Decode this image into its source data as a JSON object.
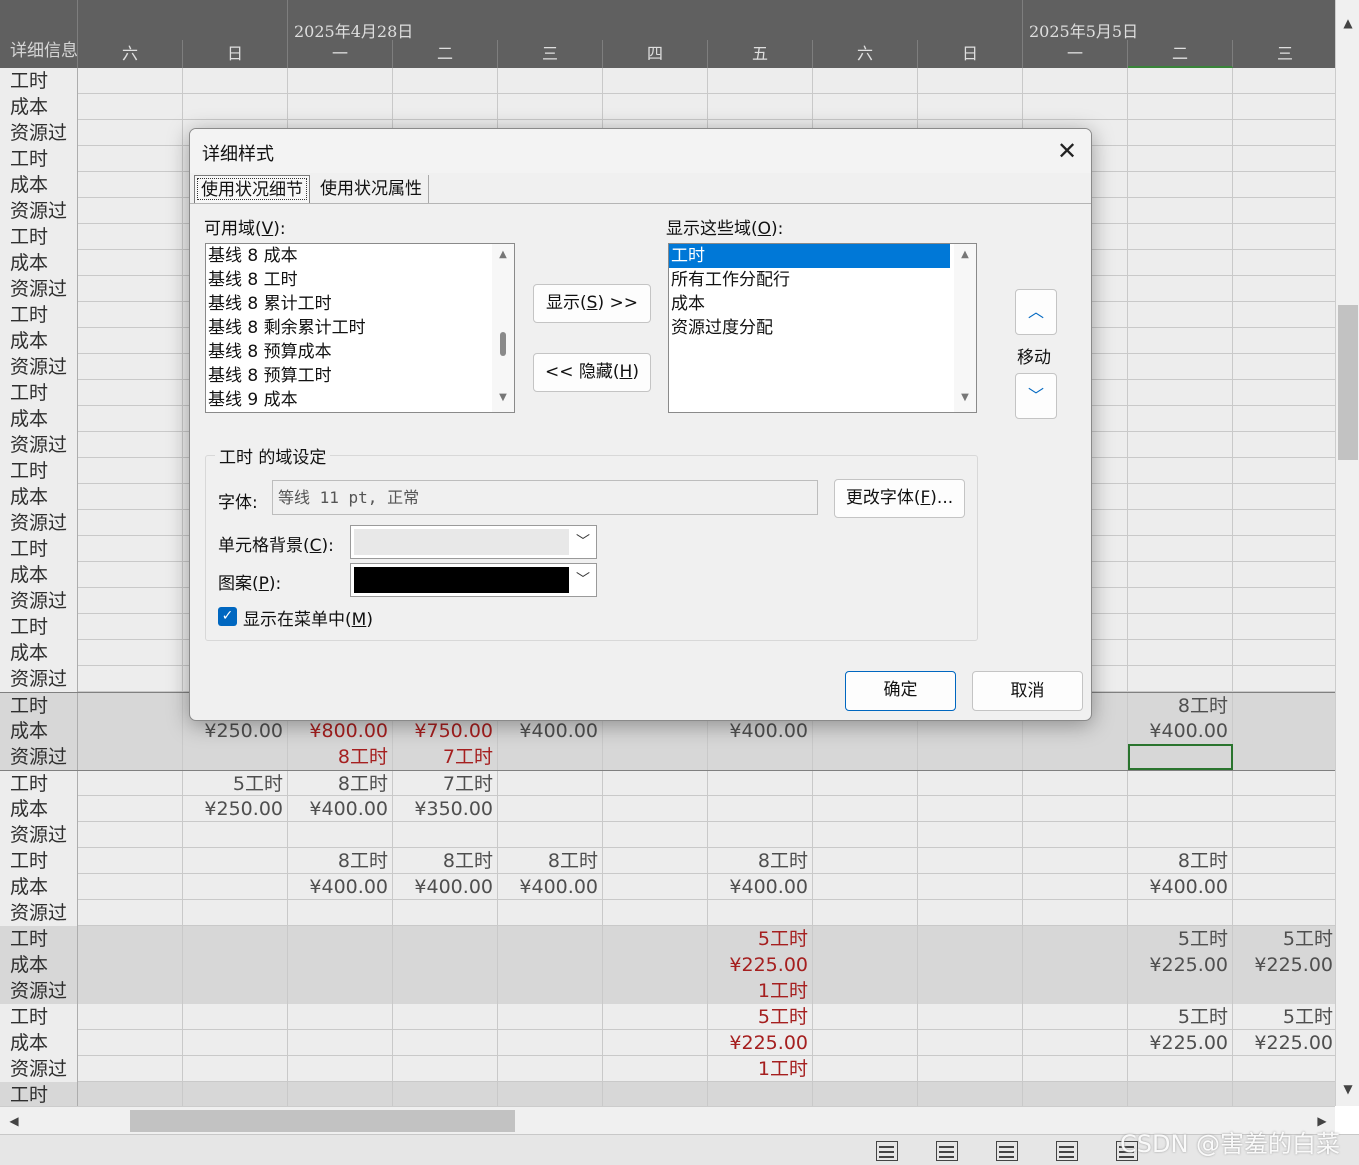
{
  "timescale": {
    "corner_label": "详细信息",
    "weeks": [
      "2025年4月28日",
      "2025年5月5日"
    ],
    "days": [
      "六",
      "日",
      "一",
      "二",
      "三",
      "四",
      "五",
      "六",
      "日",
      "一",
      "二",
      "三"
    ]
  },
  "grid": {
    "rows": [
      {
        "label": "工时",
        "cells": [
          "",
          "",
          "",
          "",
          "",
          "",
          "",
          "",
          "",
          "",
          "",
          ""
        ]
      },
      {
        "label": "成本",
        "cells": [
          "",
          "",
          "",
          "",
          "",
          "",
          "",
          "",
          "",
          "",
          "",
          ""
        ]
      },
      {
        "label": "资源过",
        "cells": [
          "",
          "",
          "",
          "",
          "",
          "",
          "",
          "",
          "",
          "",
          "",
          ""
        ]
      },
      {
        "label": "工时",
        "cells": [
          "",
          "",
          "",
          "",
          "",
          "",
          "",
          "",
          "",
          "",
          "",
          ""
        ]
      },
      {
        "label": "成本",
        "cells": [
          "",
          "",
          "",
          "",
          "",
          "",
          "",
          "",
          "",
          "",
          "",
          ""
        ]
      },
      {
        "label": "资源过",
        "cells": [
          "",
          "",
          "",
          "",
          "",
          "",
          "",
          "",
          "",
          "",
          "",
          ""
        ]
      },
      {
        "label": "工时",
        "cells": [
          "",
          "",
          "",
          "",
          "",
          "",
          "",
          "",
          "",
          "",
          "",
          ""
        ]
      },
      {
        "label": "成本",
        "cells": [
          "",
          "",
          "",
          "",
          "",
          "",
          "",
          "",
          "",
          "",
          "",
          ""
        ]
      },
      {
        "label": "资源过",
        "cells": [
          "",
          "",
          "",
          "",
          "",
          "",
          "",
          "",
          "",
          "",
          "",
          ""
        ]
      },
      {
        "label": "工时",
        "cells": [
          "",
          "",
          "",
          "",
          "",
          "",
          "",
          "",
          "",
          "",
          "",
          ""
        ]
      },
      {
        "label": "成本",
        "cells": [
          "",
          "",
          "",
          "",
          "",
          "",
          "",
          "",
          "",
          "",
          "",
          ""
        ]
      },
      {
        "label": "资源过",
        "cells": [
          "",
          "",
          "",
          "",
          "",
          "",
          "",
          "",
          "",
          "",
          "",
          ""
        ]
      },
      {
        "label": "工时",
        "cells": [
          "",
          "",
          "",
          "",
          "",
          "",
          "",
          "",
          "",
          "",
          "",
          ""
        ]
      },
      {
        "label": "成本",
        "cells": [
          "",
          "",
          "",
          "",
          "",
          "",
          "",
          "",
          "",
          "",
          "",
          ""
        ]
      },
      {
        "label": "资源过",
        "cells": [
          "",
          "",
          "",
          "",
          "",
          "",
          "",
          "",
          "",
          "",
          "",
          ""
        ]
      },
      {
        "label": "工时",
        "cells": [
          "",
          "",
          "",
          "",
          "",
          "",
          "",
          "",
          "",
          "",
          "",
          ""
        ]
      },
      {
        "label": "成本",
        "cells": [
          "",
          "",
          "",
          "",
          "",
          "",
          "",
          "",
          "",
          "",
          "",
          ""
        ]
      },
      {
        "label": "资源过",
        "cells": [
          "",
          "",
          "",
          "",
          "",
          "",
          "",
          "",
          "",
          "",
          "",
          ""
        ]
      },
      {
        "label": "工时",
        "cells": [
          "",
          "",
          "",
          "",
          "",
          "",
          "",
          "",
          "",
          "",
          "",
          ""
        ]
      },
      {
        "label": "成本",
        "cells": [
          "",
          "",
          "",
          "",
          "",
          "",
          "",
          "",
          "",
          "",
          "",
          ""
        ]
      },
      {
        "label": "资源过",
        "cells": [
          "",
          "",
          "",
          "",
          "",
          "",
          "",
          "",
          "",
          "",
          "",
          ""
        ]
      },
      {
        "label": "工时",
        "cells": [
          "",
          "",
          "",
          "",
          "",
          "",
          "",
          "",
          "",
          "",
          "",
          ""
        ]
      },
      {
        "label": "成本",
        "cells": [
          "",
          "",
          "",
          "",
          "",
          "",
          "",
          "",
          "",
          "",
          "",
          ""
        ]
      },
      {
        "label": "资源过",
        "cells": [
          "",
          "",
          "",
          "",
          "",
          "",
          "",
          "",
          "",
          "",
          "",
          ""
        ]
      },
      {
        "label": "工时",
        "shaded": true,
        "topline": true,
        "cells": [
          "",
          "",
          "",
          "",
          "",
          "",
          "",
          "",
          "",
          "",
          "8工时",
          ""
        ]
      },
      {
        "label": "成本",
        "shaded": true,
        "cells": [
          "",
          "¥250.00",
          "¥800.00",
          "¥750.00",
          "¥400.00",
          "",
          "¥400.00",
          "",
          "",
          "",
          "¥400.00",
          ""
        ],
        "red": [
          2,
          3
        ]
      },
      {
        "label": "资源过",
        "shaded": true,
        "cells": [
          "",
          "",
          "8工时",
          "7工时",
          "",
          "",
          "",
          "",
          "",
          "",
          "",
          ""
        ],
        "red": [
          2,
          3
        ],
        "selected": 10
      },
      {
        "label": "工时",
        "topline": true,
        "cells": [
          "",
          "5工时",
          "8工时",
          "7工时",
          "",
          "",
          "",
          "",
          "",
          "",
          "",
          ""
        ]
      },
      {
        "label": "成本",
        "cells": [
          "",
          "¥250.00",
          "¥400.00",
          "¥350.00",
          "",
          "",
          "",
          "",
          "",
          "",
          "",
          ""
        ]
      },
      {
        "label": "资源过",
        "cells": [
          "",
          "",
          "",
          "",
          "",
          "",
          "",
          "",
          "",
          "",
          "",
          ""
        ]
      },
      {
        "label": "工时",
        "cells": [
          "",
          "",
          "8工时",
          "8工时",
          "8工时",
          "",
          "8工时",
          "",
          "",
          "",
          "8工时",
          ""
        ]
      },
      {
        "label": "成本",
        "cells": [
          "",
          "",
          "¥400.00",
          "¥400.00",
          "¥400.00",
          "",
          "¥400.00",
          "",
          "",
          "",
          "¥400.00",
          ""
        ]
      },
      {
        "label": "资源过",
        "cells": [
          "",
          "",
          "",
          "",
          "",
          "",
          "",
          "",
          "",
          "",
          "",
          ""
        ]
      },
      {
        "label": "工时",
        "shaded": true,
        "cells": [
          "",
          "",
          "",
          "",
          "",
          "",
          "5工时",
          "",
          "",
          "",
          "5工时",
          "5工时"
        ],
        "red": [
          6
        ]
      },
      {
        "label": "成本",
        "shaded": true,
        "cells": [
          "",
          "",
          "",
          "",
          "",
          "",
          "¥225.00",
          "",
          "",
          "",
          "¥225.00",
          "¥225.00"
        ],
        "red": [
          6
        ]
      },
      {
        "label": "资源过",
        "shaded": true,
        "cells": [
          "",
          "",
          "",
          "",
          "",
          "",
          "1工时",
          "",
          "",
          "",
          "",
          ""
        ],
        "red": [
          6
        ]
      },
      {
        "label": "工时",
        "cells": [
          "",
          "",
          "",
          "",
          "",
          "",
          "5工时",
          "",
          "",
          "",
          "5工时",
          "5工时"
        ],
        "red": [
          6
        ]
      },
      {
        "label": "成本",
        "cells": [
          "",
          "",
          "",
          "",
          "",
          "",
          "¥225.00",
          "",
          "",
          "",
          "¥225.00",
          "¥225.00"
        ],
        "red": [
          6
        ]
      },
      {
        "label": "资源过",
        "cells": [
          "",
          "",
          "",
          "",
          "",
          "",
          "1工时",
          "",
          "",
          "",
          "",
          ""
        ],
        "red": [
          6
        ]
      },
      {
        "label": "工时",
        "shaded": true,
        "cells": [
          "",
          "",
          "",
          "",
          "",
          "",
          "",
          "",
          "",
          "",
          "",
          ""
        ]
      }
    ]
  },
  "dialog": {
    "title": "详细样式",
    "close_glyph": "✕",
    "tabs": [
      {
        "label": "使用状况细节",
        "active": true
      },
      {
        "label": "使用状况属性",
        "active": false
      }
    ],
    "available_label": "可用域(",
    "available_key": "V",
    "available_suffix": "):",
    "available_items": [
      "基线 8 成本",
      "基线 8 工时",
      "基线 8 累计工时",
      "基线 8 剩余累计工时",
      "基线 8 预算成本",
      "基线 8 预算工时",
      "基线 9 成本"
    ],
    "show_label": "显示这些域(",
    "show_key": "O",
    "show_suffix": "):",
    "show_items": [
      "工时",
      "所有工作分配行",
      "成本",
      "资源过度分配"
    ],
    "show_selected_index": 0,
    "show_button": {
      "pre": "显示(",
      "key": "S",
      "post": ") >>"
    },
    "hide_button": {
      "pre": "<< 隐藏(",
      "key": "H",
      "post": ")"
    },
    "move_label": "移动",
    "move_up_icon": "chevron-up",
    "move_down_icon": "chevron-down",
    "field_settings_title": "工时 的域设定",
    "font_label": "字体:",
    "font_value": "等线 11 pt, 正常",
    "change_font_button": {
      "pre": "更改字体(",
      "key": "F",
      "post": ")..."
    },
    "cell_bg_label": {
      "pre": "单元格背景(",
      "key": "C",
      "post": "):"
    },
    "cell_bg_color": "#e8e8e8",
    "pattern_label": {
      "pre": "图案(",
      "key": "P",
      "post": "):"
    },
    "pattern_color": "#000000",
    "show_in_menu": {
      "pre": "显示在菜单中(",
      "key": "M",
      "post": ")",
      "checked": true
    },
    "ok_label": "确定",
    "cancel_label": "取消"
  },
  "statusbar": {
    "view_icons": [
      "gantt-view-icon",
      "task-usage-view-icon",
      "team-planner-icon",
      "resource-usage-icon",
      "resource-sheet-icon"
    ]
  },
  "watermark": "CSDN @害羞的白菜",
  "colors": {
    "header_bg": "#686868",
    "overallocated_red": "#b22222",
    "accent_blue": "#0078d7",
    "selection_green": "#2e7d32"
  }
}
